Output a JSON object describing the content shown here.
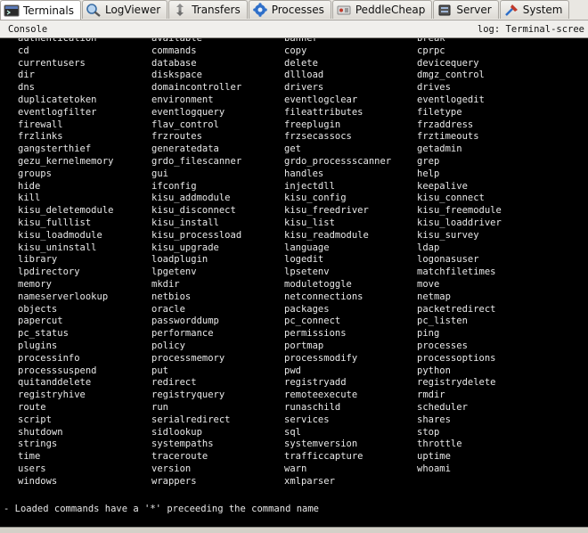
{
  "tabs": [
    {
      "label": "Terminals",
      "icon": "terminal-icon"
    },
    {
      "label": "LogViewer",
      "icon": "magnifier-icon"
    },
    {
      "label": "Transfers",
      "icon": "transfer-icon"
    },
    {
      "label": "Processes",
      "icon": "gear-icon"
    },
    {
      "label": "PeddleCheap",
      "icon": "peddlecheap-icon"
    },
    {
      "label": "Server",
      "icon": "server-icon"
    },
    {
      "label": "System",
      "icon": "system-icon"
    }
  ],
  "console": {
    "title": "Console",
    "log_label": "log: Terminal-scree"
  },
  "commands": [
    [
      "authentication",
      "available",
      "banner",
      "break"
    ],
    [
      "cd",
      "commands",
      "copy",
      "cprpc"
    ],
    [
      "currentusers",
      "database",
      "delete",
      "devicequery"
    ],
    [
      "dir",
      "diskspace",
      "dllload",
      "dmgz_control"
    ],
    [
      "dns",
      "domaincontroller",
      "drivers",
      "drives"
    ],
    [
      "duplicatetoken",
      "environment",
      "eventlogclear",
      "eventlogedit"
    ],
    [
      "eventlogfilter",
      "eventlogquery",
      "fileattributes",
      "filetype"
    ],
    [
      "firewall",
      "flav_control",
      "freeplugin",
      "frzaddress"
    ],
    [
      "frzlinks",
      "frzroutes",
      "frzsecassocs",
      "frztimeouts"
    ],
    [
      "gangsterthief",
      "generatedata",
      "get",
      "getadmin"
    ],
    [
      "gezu_kernelmemory",
      "grdo_filescanner",
      "grdo_processscanner",
      "grep"
    ],
    [
      "groups",
      "gui",
      "handles",
      "help"
    ],
    [
      "hide",
      "ifconfig",
      "injectdll",
      "keepalive"
    ],
    [
      "kill",
      "kisu_addmodule",
      "kisu_config",
      "kisu_connect"
    ],
    [
      "kisu_deletemodule",
      "kisu_disconnect",
      "kisu_freedriver",
      "kisu_freemodule"
    ],
    [
      "kisu_fulllist",
      "kisu_install",
      "kisu_list",
      "kisu_loaddriver"
    ],
    [
      "kisu_loadmodule",
      "kisu_processload",
      "kisu_readmodule",
      "kisu_survey"
    ],
    [
      "kisu_uninstall",
      "kisu_upgrade",
      "language",
      "ldap"
    ],
    [
      "library",
      "loadplugin",
      "logedit",
      "logonasuser"
    ],
    [
      "lpdirectory",
      "lpgetenv",
      "lpsetenv",
      "matchfiletimes"
    ],
    [
      "memory",
      "mkdir",
      "moduletoggle",
      "move"
    ],
    [
      "nameserverlookup",
      "netbios",
      "netconnections",
      "netmap"
    ],
    [
      "objects",
      "oracle",
      "packages",
      "packetredirect"
    ],
    [
      "papercut",
      "passworddump",
      "pc_connect",
      "pc_listen"
    ],
    [
      "pc_status",
      "performance",
      "permissions",
      "ping"
    ],
    [
      "plugins",
      "policy",
      "portmap",
      "processes"
    ],
    [
      "processinfo",
      "processmemory",
      "processmodify",
      "processoptions"
    ],
    [
      "processsuspend",
      "put",
      "pwd",
      "python"
    ],
    [
      "quitanddelete",
      "redirect",
      "registryadd",
      "registrydelete"
    ],
    [
      "registryhive",
      "registryquery",
      "remoteexecute",
      "rmdir"
    ],
    [
      "route",
      "run",
      "runaschild",
      "scheduler"
    ],
    [
      "script",
      "serialredirect",
      "services",
      "shares"
    ],
    [
      "shutdown",
      "sidlookup",
      "sql",
      "stop"
    ],
    [
      "strings",
      "systempaths",
      "systemversion",
      "throttle"
    ],
    [
      "time",
      "traceroute",
      "trafficcapture",
      "uptime"
    ],
    [
      "users",
      "version",
      "warn",
      "whoami"
    ],
    [
      "windows",
      "wrappers",
      "xmlparser",
      ""
    ]
  ],
  "footer_note": "- Loaded commands have a '*' preceeding the command name"
}
